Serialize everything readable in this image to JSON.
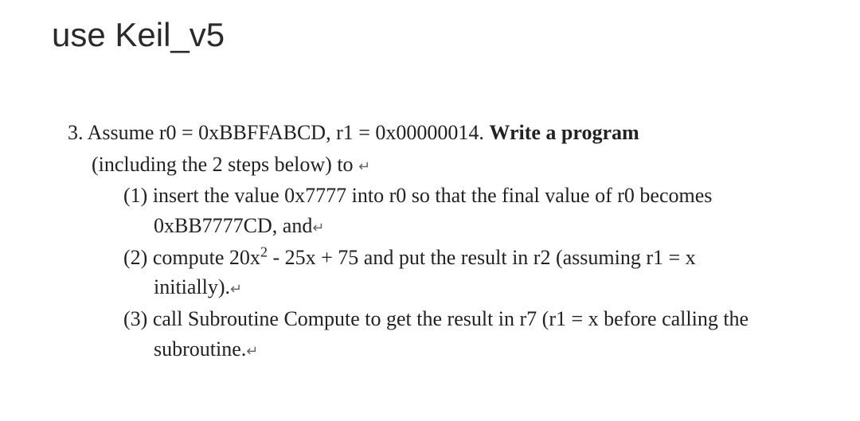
{
  "title": "use Keil_v5",
  "problem": {
    "number": "3.",
    "intro_prefix": "Assume r0 = 0xBBFFABCD, r1 = 0x00000014. ",
    "intro_bold": "Write a program",
    "sub_intro": "(including the 2 steps below) to",
    "items": [
      {
        "num": "(1)",
        "text_a": "insert the value 0x7777 into r0 so that the final value of r0 becomes 0xBB7777CD, and"
      },
      {
        "num": "(2)",
        "text_a": "compute 20x",
        "sup": "2",
        "text_b": " - 25x + 75 and put the result in r2 (assuming r1 = x initially)."
      },
      {
        "num": "(3)",
        "text_a": "call Subroutine Compute to get the result in r7 (r1 = x before calling the subroutine."
      }
    ]
  },
  "pmark": "↵"
}
